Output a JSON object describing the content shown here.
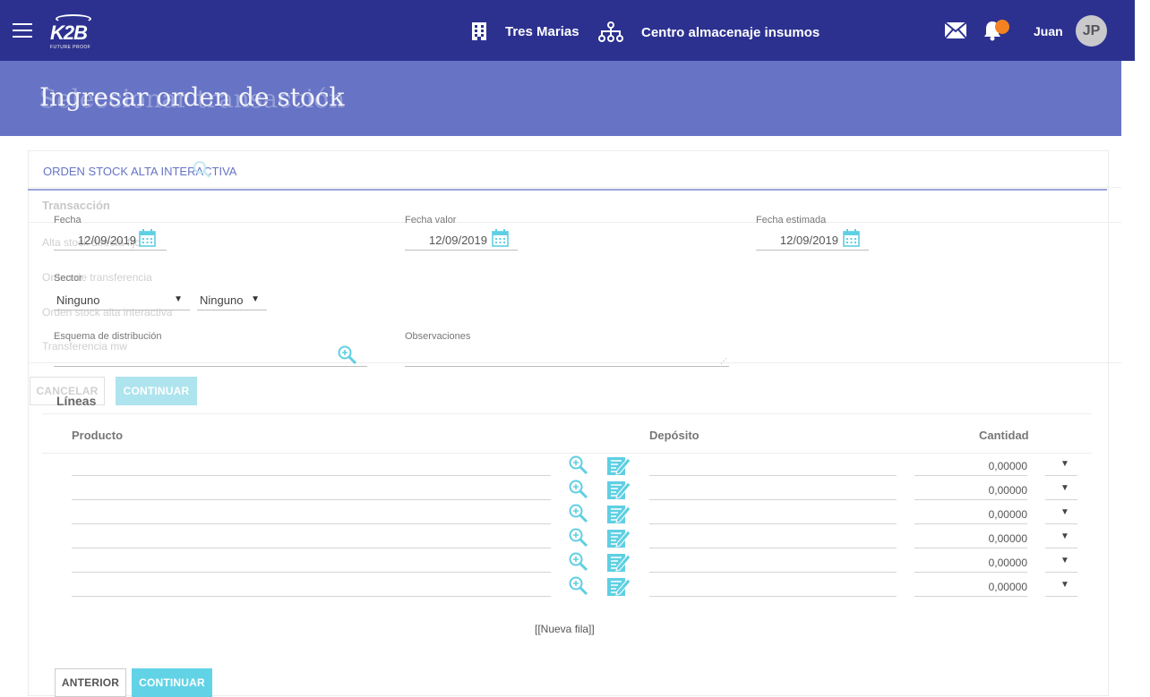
{
  "topbar": {
    "logo": "K2B",
    "logo_sub": "FUTURE PROOF",
    "company": "Tres Marias",
    "unit": "Centro almacenaje insumos",
    "user": "Juan",
    "avatar": "JP",
    "icons": [
      "menu-icon",
      "building-icon",
      "org-chart-icon",
      "mail-icon",
      "bell-icon"
    ],
    "colors": {
      "bar": "#2c3190",
      "notification": "#f58220"
    }
  },
  "header": {
    "title": "Ingresar orden de stock",
    "ghost_title": "Seleccionar transacción",
    "color": "#6774c5"
  },
  "tab": {
    "label": "ORDEN STOCK ALTA INTERACTIVA"
  },
  "background_ghost": {
    "section": "Transacción",
    "items": [
      "Alta stock directa fijo",
      "Orden de transferencia",
      "Orden stock alta interactiva",
      "Transferencia mw"
    ],
    "cancel": "CANCELAR",
    "continue": "CONTINUAR"
  },
  "form": {
    "fecha_label": "Fecha",
    "fecha_value": "12/09/2019",
    "fecha_valor_label": "Fecha valor",
    "fecha_valor_value": "12/09/2019",
    "fecha_estimada_label": "Fecha estimada",
    "fecha_estimada_value": "12/09/2019",
    "sector_label": "Sector",
    "sector_value_1": "Ninguno",
    "sector_value_2": "Ninguno",
    "esquema_label": "Esquema de distribución",
    "esquema_value": "",
    "observaciones_label": "Observaciones",
    "observaciones_value": ""
  },
  "lines": {
    "title": "Líneas",
    "columns": {
      "product": "Producto",
      "deposit": "Depósito",
      "quantity": "Cantidad"
    },
    "rows": [
      {
        "product": "",
        "deposit": "",
        "quantity": "0,00000"
      },
      {
        "product": "",
        "deposit": "",
        "quantity": "0,00000"
      },
      {
        "product": "",
        "deposit": "",
        "quantity": "0,00000"
      },
      {
        "product": "",
        "deposit": "",
        "quantity": "0,00000"
      },
      {
        "product": "",
        "deposit": "",
        "quantity": "0,00000"
      },
      {
        "product": "",
        "deposit": "",
        "quantity": "0,00000"
      }
    ],
    "new_row": "[[Nueva fila]]"
  },
  "footer": {
    "previous": "ANTERIOR",
    "continue": "CONTINUAR"
  }
}
